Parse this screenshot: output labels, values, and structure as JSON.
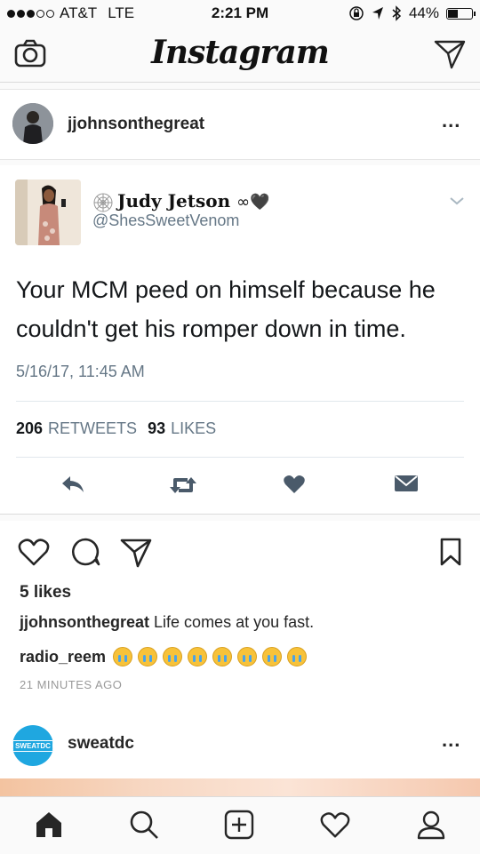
{
  "status_bar": {
    "carrier": "AT&T",
    "network": "LTE",
    "time": "2:21 PM",
    "battery": "44%",
    "battery_level": 0.44
  },
  "header": {
    "title": "Instagram",
    "left_icon": "camera-icon",
    "right_icon": "direct-message-icon"
  },
  "post": {
    "username": "jjohnsonthegreat",
    "more_label": "...",
    "tweet": {
      "display_name": "Judy Jetson",
      "name_emoji": "∞🖤",
      "handle": "@ShesSweetVenom",
      "text": "Your MCM peed on himself because he couldn't get his romper down in time.",
      "date": "5/16/17, 11:45 AM",
      "retweets_count": "206",
      "retweets_label": "RETWEETS",
      "likes_count": "93",
      "likes_label": "LIKES"
    },
    "likes": "5 likes",
    "caption_user": "jjohnsonthegreat",
    "caption_text": "Life comes at you fast.",
    "comment_user": "radio_reem",
    "comment_emoji_count": 8,
    "time_ago": "21 MINUTES AGO"
  },
  "next_post": {
    "username": "sweatdc",
    "avatar_text": "SWEATDC",
    "more_label": "..."
  },
  "bottom_nav": [
    "home-icon",
    "search-icon",
    "add-post-icon",
    "activity-heart-icon",
    "profile-icon"
  ],
  "colors": {
    "twitter_gray": "#657786",
    "tweet_action": "#4a5a6a",
    "sweatdc_blue": "#1fa7e0"
  }
}
